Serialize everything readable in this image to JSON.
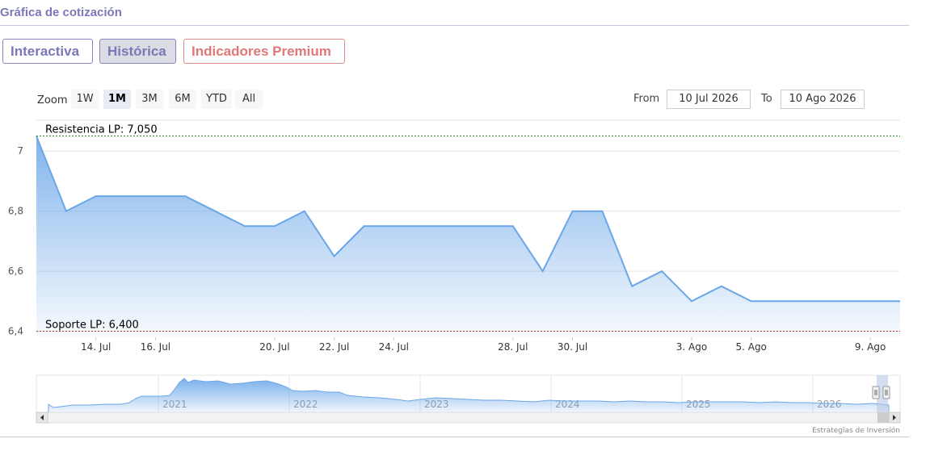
{
  "header": {
    "title": "Gráfica de cotización"
  },
  "tabs": [
    {
      "label": "Interactiva"
    },
    {
      "label": "Histórica"
    },
    {
      "label": "Indicadores Premium"
    }
  ],
  "range_selector": {
    "zoom_label": "Zoom",
    "buttons": [
      "1W",
      "1M",
      "3M",
      "6M",
      "YTD",
      "All"
    ],
    "active": "1M",
    "from_label": "From",
    "from_value": "10 Jul 2026",
    "to_label": "To",
    "to_value": "10 Ago 2026"
  },
  "credits": "Estrategias de Inversión",
  "navigator": {
    "year_labels": [
      "2021",
      "2022",
      "2023",
      "2024",
      "2025",
      "2026"
    ]
  },
  "colors": {
    "line": "#6aa6e8",
    "resistance": "#1a7a1a",
    "support": "#c0392b"
  },
  "chart_data": {
    "type": "area",
    "title": "",
    "xlabel": "",
    "ylabel": "",
    "x": [
      "2026-07-12",
      "2026-07-13",
      "2026-07-14",
      "2026-07-15",
      "2026-07-16",
      "2026-07-17",
      "2026-07-18",
      "2026-07-19",
      "2026-07-20",
      "2026-07-21",
      "2026-07-22",
      "2026-07-23",
      "2026-07-24",
      "2026-07-25",
      "2026-07-26",
      "2026-07-27",
      "2026-07-28",
      "2026-07-29",
      "2026-07-30",
      "2026-07-31",
      "2026-08-01",
      "2026-08-02",
      "2026-08-03",
      "2026-08-04",
      "2026-08-05",
      "2026-08-06",
      "2026-08-07",
      "2026-08-08",
      "2026-08-09",
      "2026-08-10"
    ],
    "values": [
      7.05,
      6.8,
      6.85,
      6.85,
      6.85,
      6.85,
      6.8,
      6.75,
      6.75,
      6.8,
      6.65,
      6.75,
      6.75,
      6.75,
      6.75,
      6.75,
      6.75,
      6.6,
      6.8,
      6.8,
      6.55,
      6.6,
      6.5,
      6.55,
      6.5,
      6.5,
      6.5,
      6.5,
      6.5,
      6.5
    ],
    "ylim": [
      6.38,
      7.1
    ],
    "y_ticks": [
      "6,4",
      "6,6",
      "6,8",
      "7"
    ],
    "x_tick_labels": [
      {
        "date": "2026-07-14",
        "label": "14. Jul"
      },
      {
        "date": "2026-07-16",
        "label": "16. Jul"
      },
      {
        "date": "2026-07-20",
        "label": "20. Jul"
      },
      {
        "date": "2026-07-22",
        "label": "22. Jul"
      },
      {
        "date": "2026-07-24",
        "label": "24. Jul"
      },
      {
        "date": "2026-07-28",
        "label": "28. Jul"
      },
      {
        "date": "2026-07-30",
        "label": "30. Jul"
      },
      {
        "date": "2026-08-03",
        "label": "3. Ago"
      },
      {
        "date": "2026-08-05",
        "label": "5. Ago"
      },
      {
        "date": "2026-08-09",
        "label": "9. Ago"
      }
    ],
    "resistance": {
      "label": "Resistencia LP: 7,050",
      "value": 7.05
    },
    "support": {
      "label": "Soporte LP: 6,400",
      "value": 6.4
    },
    "grid": true,
    "legend": "none"
  }
}
